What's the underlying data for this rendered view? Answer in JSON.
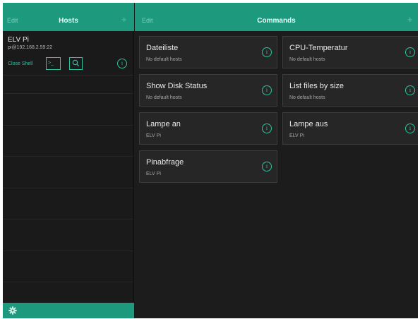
{
  "colors": {
    "accent": "#1d9a7d",
    "accent_text": "#2cc39f",
    "background": "#1c1c1c",
    "card": "#262626"
  },
  "hosts_pane": {
    "edit_label": "Edit",
    "title": "Hosts",
    "add_icon": "plus-icon",
    "hosts": [
      {
        "name": "ELV Pi",
        "address": "pi@192.168.2.59:22",
        "close_shell_label": "Close Shell",
        "terminal_icon": "terminal-icon",
        "terminal_glyph": ">_",
        "search_icon": "search-icon",
        "info_icon": "info-icon",
        "info_glyph": "i"
      }
    ],
    "footer": {
      "settings_icon": "gear-icon"
    }
  },
  "commands_pane": {
    "edit_label": "Edit",
    "title": "Commands",
    "add_icon": "plus-icon",
    "commands": [
      {
        "title": "Dateiliste",
        "hosts": "No default hosts",
        "info_glyph": "i"
      },
      {
        "title": "CPU-Temperatur",
        "hosts": "No default hosts",
        "info_glyph": "i"
      },
      {
        "title": "Show Disk Status",
        "hosts": "No default hosts",
        "info_glyph": "i"
      },
      {
        "title": "List files by size",
        "hosts": "No default hosts",
        "info_glyph": "i"
      },
      {
        "title": "Lampe an",
        "hosts": "ELV Pi",
        "info_glyph": "i"
      },
      {
        "title": "Lampe aus",
        "hosts": "ELV Pi",
        "info_glyph": "i"
      },
      {
        "title": "Pinabfrage",
        "hosts": "ELV Pi",
        "info_glyph": "i"
      }
    ]
  }
}
